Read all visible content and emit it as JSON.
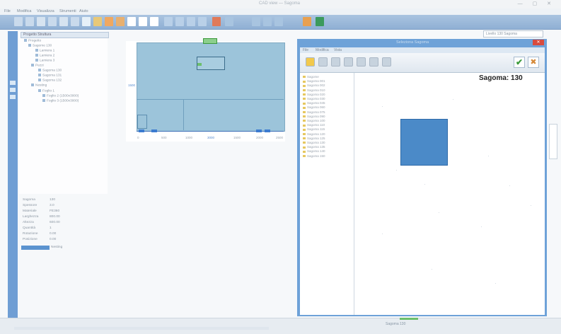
{
  "window": {
    "title": "CAD view — Sagoma",
    "controls": "— ▢ ✕"
  },
  "menubar": {
    "items": [
      "File",
      "Modifica",
      "Visualizza",
      "Strumenti",
      "Aiuto"
    ]
  },
  "ribbon": {
    "right_box": "Livello 130 Sagoma"
  },
  "tree": {
    "tab_label": "Progetto Struttura",
    "nodes": [
      "Progetto",
      "Sagome 130",
      "Lamiera 1",
      "Lamiera 2",
      "Lamiera 3",
      "Pezzi",
      "Sagoma 130",
      "Sagoma 131",
      "Sagoma 132",
      "Nesting",
      "Foglio 1",
      "Foglio 2 (1500x3000)",
      "Foglio 3 (1500x3000)"
    ]
  },
  "properties": {
    "rows": [
      {
        "key": "Sagoma",
        "value": "130"
      },
      {
        "key": "Spessore",
        "value": "3.0"
      },
      {
        "key": "Materiale",
        "value": "FE360"
      },
      {
        "key": "Larghezza",
        "value": "800.00"
      },
      {
        "key": "Altezza",
        "value": "600.00"
      },
      {
        "key": "Quantità",
        "value": "1"
      },
      {
        "key": "Rotazione",
        "value": "0.00"
      },
      {
        "key": "Posizione",
        "value": "0.00"
      }
    ],
    "selected_value": "Nesting"
  },
  "preview": {
    "x_label": "3000",
    "y_label": "1500",
    "x_ticks": [
      "0",
      "500",
      "1000",
      "1500",
      "2000",
      "2500"
    ]
  },
  "dialog": {
    "title": "Seleziona Sagoma",
    "close_label": "✕",
    "menu": [
      "File",
      "Modifica",
      "Vista"
    ],
    "ok_label": "✔",
    "cancel_label": "✖",
    "sagoma_label": "Sagoma: 130",
    "list_items": [
      "Sagome",
      "Sagoma 001",
      "Sagoma 002",
      "Sagoma 010",
      "Sagoma 020",
      "Sagoma 030",
      "Sagoma 045",
      "Sagoma 060",
      "Sagoma 075",
      "Sagoma 090",
      "Sagoma 100",
      "Sagoma 110",
      "Sagoma 115",
      "Sagoma 120",
      "Sagoma 125",
      "Sagoma 130",
      "Sagoma 135",
      "Sagoma 140",
      "Sagoma 150"
    ]
  },
  "statusbar": {
    "center_text": "Sagoma 130"
  },
  "colors": {
    "ribbon": "#8fb0d4",
    "dialog_frame": "#6ea2d8",
    "sagoma_fill": "#4b8ac8",
    "preview_fill": "#9cc4da"
  }
}
